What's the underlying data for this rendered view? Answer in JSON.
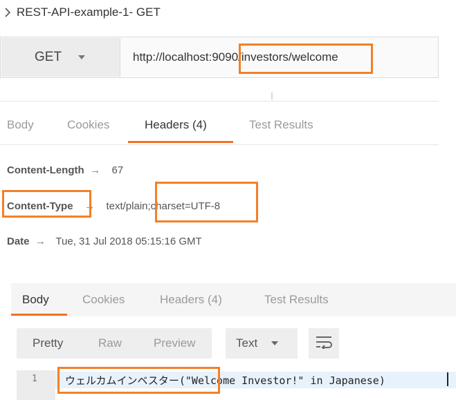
{
  "request": {
    "title": "REST-API-example-1- GET",
    "method": "GET",
    "url": "http://localhost:9090/investors/welcome"
  },
  "response_tabs_top": [
    {
      "label": "Body"
    },
    {
      "label": "Cookies"
    },
    {
      "label": "Headers (4)",
      "active": true
    },
    {
      "label": "Test Results"
    }
  ],
  "headers": [
    {
      "key": "Content-Length",
      "value": "67"
    },
    {
      "key": "Content-Type",
      "value": "text/plain;charset=UTF-8"
    },
    {
      "key": "Date",
      "value": "Tue, 31 Jul 2018 05:15:16 GMT"
    }
  ],
  "arrow": "→",
  "response_tabs_bottom": [
    {
      "label": "Body",
      "active": true
    },
    {
      "label": "Cookies"
    },
    {
      "label": "Headers (4)"
    },
    {
      "label": "Test Results"
    }
  ],
  "toolbar": {
    "pretty": "Pretty",
    "raw": "Raw",
    "preview": "Preview",
    "format": "Text"
  },
  "editor": {
    "line_number": "1",
    "code": "ウェルカムインベスター(\"Welcome Investor!\" in Japanese)"
  },
  "colors": {
    "accent": "#f47023",
    "highlight_box": "#f47f27"
  },
  "icons": [
    "chevron-right-icon",
    "dropdown-caret-icon",
    "wrap-lines-icon"
  ]
}
